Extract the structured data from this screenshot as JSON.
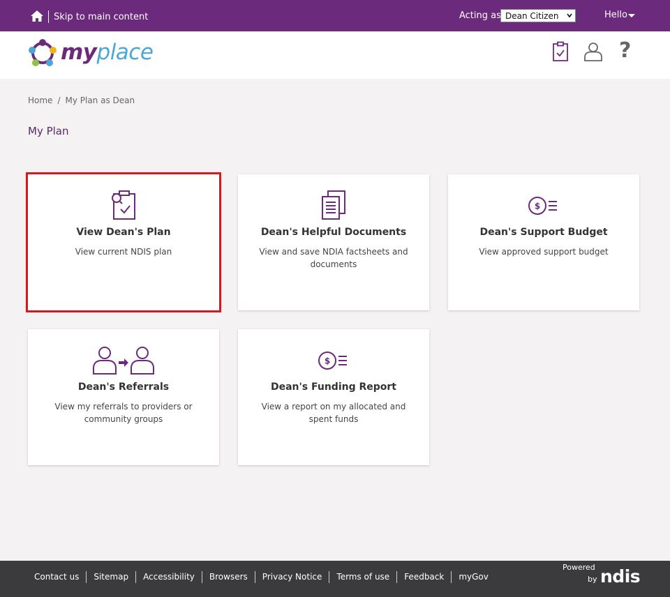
{
  "topbar": {
    "skip_link": "Skip to main content",
    "acting_as_label": "Acting as",
    "acting_as_value": "Dean Citizen",
    "hello_label": "Hello"
  },
  "header": {
    "logo_my": "my",
    "logo_place": "place"
  },
  "breadcrumb": {
    "home": "Home",
    "separator": "/",
    "current": "My Plan as Dean"
  },
  "page": {
    "title": "My Plan"
  },
  "cards": [
    {
      "title": "View Dean's Plan",
      "desc": "View current NDIS plan"
    },
    {
      "title": "Dean's Helpful Documents",
      "desc": "View and save NDIA factsheets and documents"
    },
    {
      "title": "Dean's Support Budget",
      "desc": "View approved support budget"
    },
    {
      "title": "Dean's Referrals",
      "desc": "View my referrals to providers or community groups"
    },
    {
      "title": "Dean's Funding Report",
      "desc": "View a report on my allocated and spent funds"
    }
  ],
  "footer": {
    "links": [
      "Contact us",
      "Sitemap",
      "Accessibility",
      "Browsers",
      "Privacy Notice",
      "Terms of use",
      "Feedback",
      "myGov"
    ],
    "powered": "Powered",
    "by": "by",
    "brand": "ndis"
  },
  "colors": {
    "brand_purple": "#6c2a7c",
    "accent_blue": "#4aa7d8",
    "highlight_red": "#e0141c",
    "footer_bg": "#3b3b3d"
  },
  "icons": {
    "home": "home-icon",
    "tasks": "clipboard-check-icon",
    "profile": "person-icon",
    "help": "question-icon"
  }
}
